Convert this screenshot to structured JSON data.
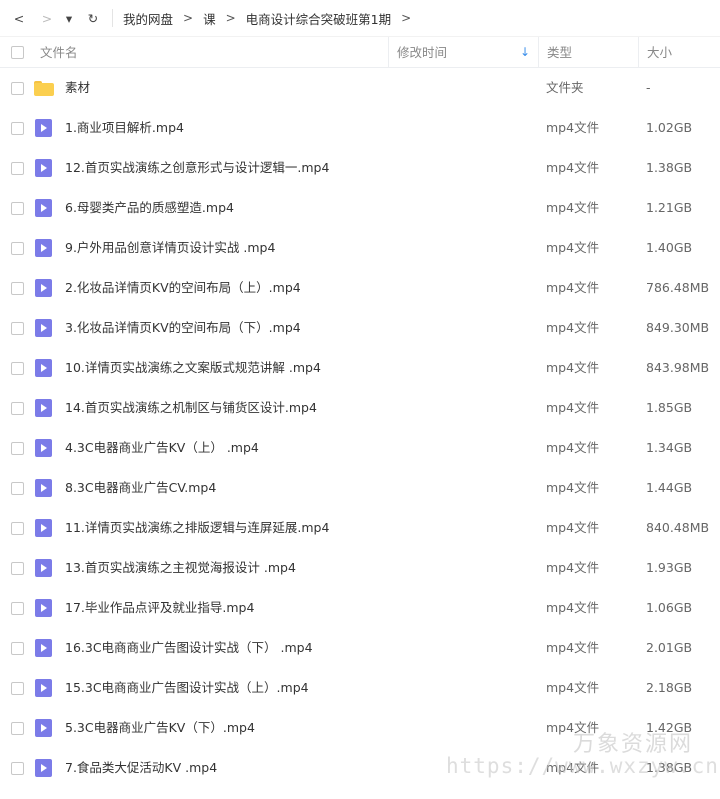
{
  "nav": {
    "back_label": "<",
    "forward_label": ">",
    "dropdown_label": "▾",
    "refresh_label": "↻"
  },
  "breadcrumb": {
    "items": [
      "我的网盘",
      "课",
      "电商设计综合突破班第1期"
    ],
    "separator": ">"
  },
  "columns": {
    "name": "文件名",
    "modified": "修改时间",
    "type": "类型",
    "size": "大小",
    "sort_arrow": "↓"
  },
  "files": [
    {
      "icon": "folder-icon",
      "name": "素材",
      "type": "文件夹",
      "size": "-"
    },
    {
      "icon": "video-icon",
      "name": "1.商业项目解析.mp4",
      "type": "mp4文件",
      "size": "1.02GB"
    },
    {
      "icon": "video-icon",
      "name": "12.首页实战演练之创意形式与设计逻辑一.mp4",
      "type": "mp4文件",
      "size": "1.38GB"
    },
    {
      "icon": "video-icon",
      "name": "6.母婴类产品的质感塑造.mp4",
      "type": "mp4文件",
      "size": "1.21GB"
    },
    {
      "icon": "video-icon",
      "name": "9.户外用品创意详情页设计实战 .mp4",
      "type": "mp4文件",
      "size": "1.40GB"
    },
    {
      "icon": "video-icon",
      "name": "2.化妆品详情页KV的空间布局（上）.mp4",
      "type": "mp4文件",
      "size": "786.48MB"
    },
    {
      "icon": "video-icon",
      "name": "3.化妆品详情页KV的空间布局（下）.mp4",
      "type": "mp4文件",
      "size": "849.30MB"
    },
    {
      "icon": "video-icon",
      "name": "10.详情页实战演练之文案版式规范讲解 .mp4",
      "type": "mp4文件",
      "size": "843.98MB"
    },
    {
      "icon": "video-icon",
      "name": "14.首页实战演练之机制区与铺货区设计.mp4",
      "type": "mp4文件",
      "size": "1.85GB"
    },
    {
      "icon": "video-icon",
      "name": "4.3C电器商业广告KV（上） .mp4",
      "type": "mp4文件",
      "size": "1.34GB"
    },
    {
      "icon": "video-icon",
      "name": "8.3C电器商业广告CV.mp4",
      "type": "mp4文件",
      "size": "1.44GB"
    },
    {
      "icon": "video-icon",
      "name": "11.详情页实战演练之排版逻辑与连屏延展.mp4",
      "type": "mp4文件",
      "size": "840.48MB"
    },
    {
      "icon": "video-icon",
      "name": "13.首页实战演练之主视觉海报设计 .mp4",
      "type": "mp4文件",
      "size": "1.93GB"
    },
    {
      "icon": "video-icon",
      "name": "17.毕业作品点评及就业指导.mp4",
      "type": "mp4文件",
      "size": "1.06GB"
    },
    {
      "icon": "video-icon",
      "name": "16.3C电商商业广告图设计实战（下） .mp4",
      "type": "mp4文件",
      "size": "2.01GB"
    },
    {
      "icon": "video-icon",
      "name": "15.3C电商商业广告图设计实战（上）.mp4",
      "type": "mp4文件",
      "size": "2.18GB"
    },
    {
      "icon": "video-icon",
      "name": "5.3C电器商业广告KV（下）.mp4",
      "type": "mp4文件",
      "size": "1.42GB"
    },
    {
      "icon": "video-icon",
      "name": "7.食品类大促活动KV .mp4",
      "type": "mp4文件",
      "size": "1.38GB"
    }
  ],
  "watermark": {
    "text_cn": "万象资源网",
    "url": "https://www.wxzyw.cn"
  },
  "colors": {
    "video_icon": "#7b7be8",
    "folder_icon": "#fbcf4f",
    "sort_arrow": "#3a8eea"
  }
}
